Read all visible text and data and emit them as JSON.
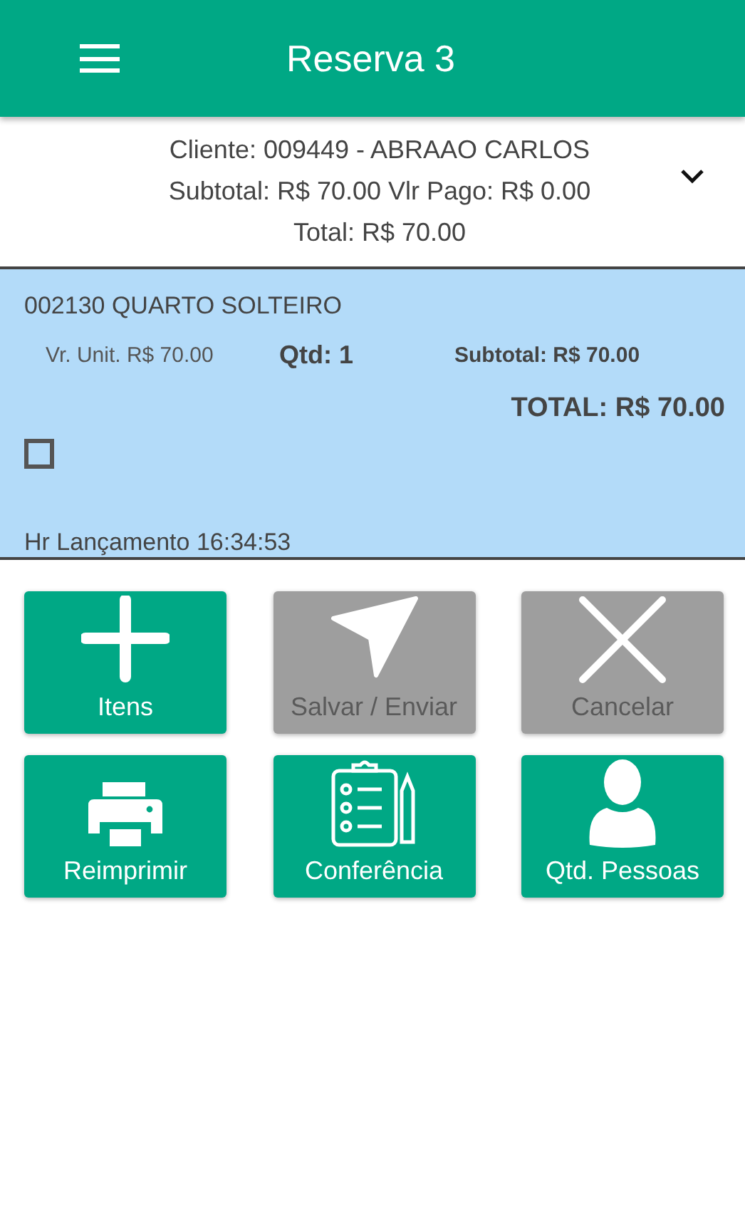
{
  "header": {
    "title": "Reserva 3"
  },
  "summary": {
    "client": "Cliente: 009449 - ABRAAO CARLOS",
    "subtotal_line": "Subtotal: R$ 70.00 Vlr Pago: R$ 0.00",
    "total": "Total: R$ 70.00",
    "expanded": false
  },
  "items": [
    {
      "name": "002130 QUARTO SOLTEIRO",
      "unit_price": "Vr. Unit. R$ 70.00",
      "qty": "Qtd: 1",
      "subtotal": "Subtotal: R$ 70.00",
      "total": "TOTAL: R$ 70.00",
      "checked": false,
      "time": "Hr Lançamento 16:34:53"
    }
  ],
  "actions": [
    {
      "kind": "plus",
      "label": "Itens",
      "disabled": false
    },
    {
      "kind": "send",
      "label": "Salvar / Enviar",
      "disabled": true
    },
    {
      "kind": "close",
      "label": "Cancelar",
      "disabled": true
    },
    {
      "kind": "printer",
      "label": "Reimprimir",
      "disabled": false
    },
    {
      "kind": "checklist",
      "label": "Conferência",
      "disabled": false
    },
    {
      "kind": "person",
      "label": "Qtd. Pessoas",
      "disabled": false
    }
  ]
}
